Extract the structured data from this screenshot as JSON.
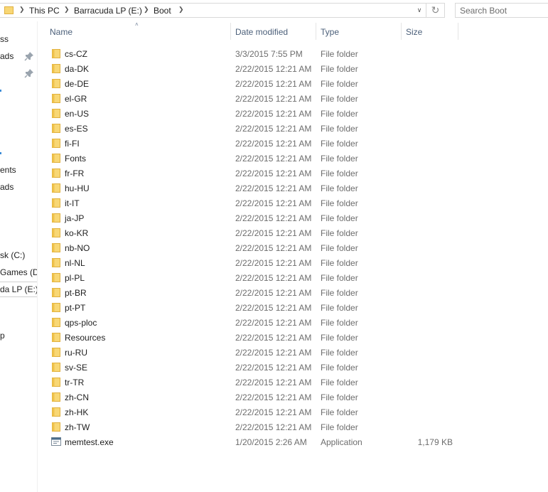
{
  "address_bar": {
    "breadcrumbs": [
      "This PC",
      "Barracuda LP (E:)",
      "Boot"
    ],
    "dropdown_icon": "chevron-down",
    "refresh_icon": "refresh"
  },
  "search": {
    "placeholder": "Search Boot"
  },
  "nav_pane": {
    "items": [
      {
        "label": "ss",
        "pinned": false
      },
      {
        "label": "ads",
        "pinned": true
      },
      {
        "label": "",
        "pinned": true
      },
      {
        "label": "ents",
        "pinned": false
      },
      {
        "label": "ads",
        "pinned": false
      },
      {
        "label": "sk (C:)",
        "pinned": false
      },
      {
        "label": "Games (D:)",
        "pinned": false
      },
      {
        "label": "da LP (E:)",
        "pinned": false,
        "selected": true
      },
      {
        "label": "p",
        "pinned": false
      }
    ]
  },
  "columns": {
    "name": "Name",
    "date": "Date modified",
    "type": "Type",
    "size": "Size"
  },
  "files": [
    {
      "name": "cs-CZ",
      "date": "3/3/2015 7:55 PM",
      "type": "File folder",
      "size": "",
      "icon": "folder"
    },
    {
      "name": "da-DK",
      "date": "2/22/2015 12:21 AM",
      "type": "File folder",
      "size": "",
      "icon": "folder"
    },
    {
      "name": "de-DE",
      "date": "2/22/2015 12:21 AM",
      "type": "File folder",
      "size": "",
      "icon": "folder"
    },
    {
      "name": "el-GR",
      "date": "2/22/2015 12:21 AM",
      "type": "File folder",
      "size": "",
      "icon": "folder"
    },
    {
      "name": "en-US",
      "date": "2/22/2015 12:21 AM",
      "type": "File folder",
      "size": "",
      "icon": "folder"
    },
    {
      "name": "es-ES",
      "date": "2/22/2015 12:21 AM",
      "type": "File folder",
      "size": "",
      "icon": "folder"
    },
    {
      "name": "fi-FI",
      "date": "2/22/2015 12:21 AM",
      "type": "File folder",
      "size": "",
      "icon": "folder"
    },
    {
      "name": "Fonts",
      "date": "2/22/2015 12:21 AM",
      "type": "File folder",
      "size": "",
      "icon": "folder"
    },
    {
      "name": "fr-FR",
      "date": "2/22/2015 12:21 AM",
      "type": "File folder",
      "size": "",
      "icon": "folder"
    },
    {
      "name": "hu-HU",
      "date": "2/22/2015 12:21 AM",
      "type": "File folder",
      "size": "",
      "icon": "folder"
    },
    {
      "name": "it-IT",
      "date": "2/22/2015 12:21 AM",
      "type": "File folder",
      "size": "",
      "icon": "folder"
    },
    {
      "name": "ja-JP",
      "date": "2/22/2015 12:21 AM",
      "type": "File folder",
      "size": "",
      "icon": "folder"
    },
    {
      "name": "ko-KR",
      "date": "2/22/2015 12:21 AM",
      "type": "File folder",
      "size": "",
      "icon": "folder"
    },
    {
      "name": "nb-NO",
      "date": "2/22/2015 12:21 AM",
      "type": "File folder",
      "size": "",
      "icon": "folder"
    },
    {
      "name": "nl-NL",
      "date": "2/22/2015 12:21 AM",
      "type": "File folder",
      "size": "",
      "icon": "folder"
    },
    {
      "name": "pl-PL",
      "date": "2/22/2015 12:21 AM",
      "type": "File folder",
      "size": "",
      "icon": "folder"
    },
    {
      "name": "pt-BR",
      "date": "2/22/2015 12:21 AM",
      "type": "File folder",
      "size": "",
      "icon": "folder"
    },
    {
      "name": "pt-PT",
      "date": "2/22/2015 12:21 AM",
      "type": "File folder",
      "size": "",
      "icon": "folder"
    },
    {
      "name": "qps-ploc",
      "date": "2/22/2015 12:21 AM",
      "type": "File folder",
      "size": "",
      "icon": "folder"
    },
    {
      "name": "Resources",
      "date": "2/22/2015 12:21 AM",
      "type": "File folder",
      "size": "",
      "icon": "folder"
    },
    {
      "name": "ru-RU",
      "date": "2/22/2015 12:21 AM",
      "type": "File folder",
      "size": "",
      "icon": "folder"
    },
    {
      "name": "sv-SE",
      "date": "2/22/2015 12:21 AM",
      "type": "File folder",
      "size": "",
      "icon": "folder"
    },
    {
      "name": "tr-TR",
      "date": "2/22/2015 12:21 AM",
      "type": "File folder",
      "size": "",
      "icon": "folder"
    },
    {
      "name": "zh-CN",
      "date": "2/22/2015 12:21 AM",
      "type": "File folder",
      "size": "",
      "icon": "folder"
    },
    {
      "name": "zh-HK",
      "date": "2/22/2015 12:21 AM",
      "type": "File folder",
      "size": "",
      "icon": "folder"
    },
    {
      "name": "zh-TW",
      "date": "2/22/2015 12:21 AM",
      "type": "File folder",
      "size": "",
      "icon": "folder"
    },
    {
      "name": "memtest.exe",
      "date": "1/20/2015 2:26 AM",
      "type": "Application",
      "size": "1,179 KB",
      "icon": "application"
    }
  ],
  "colors": {
    "folder_fill": "#f8d775",
    "folder_edge": "#e0b03f",
    "header_text": "#4c607a",
    "accent": "#3a8bd6"
  }
}
